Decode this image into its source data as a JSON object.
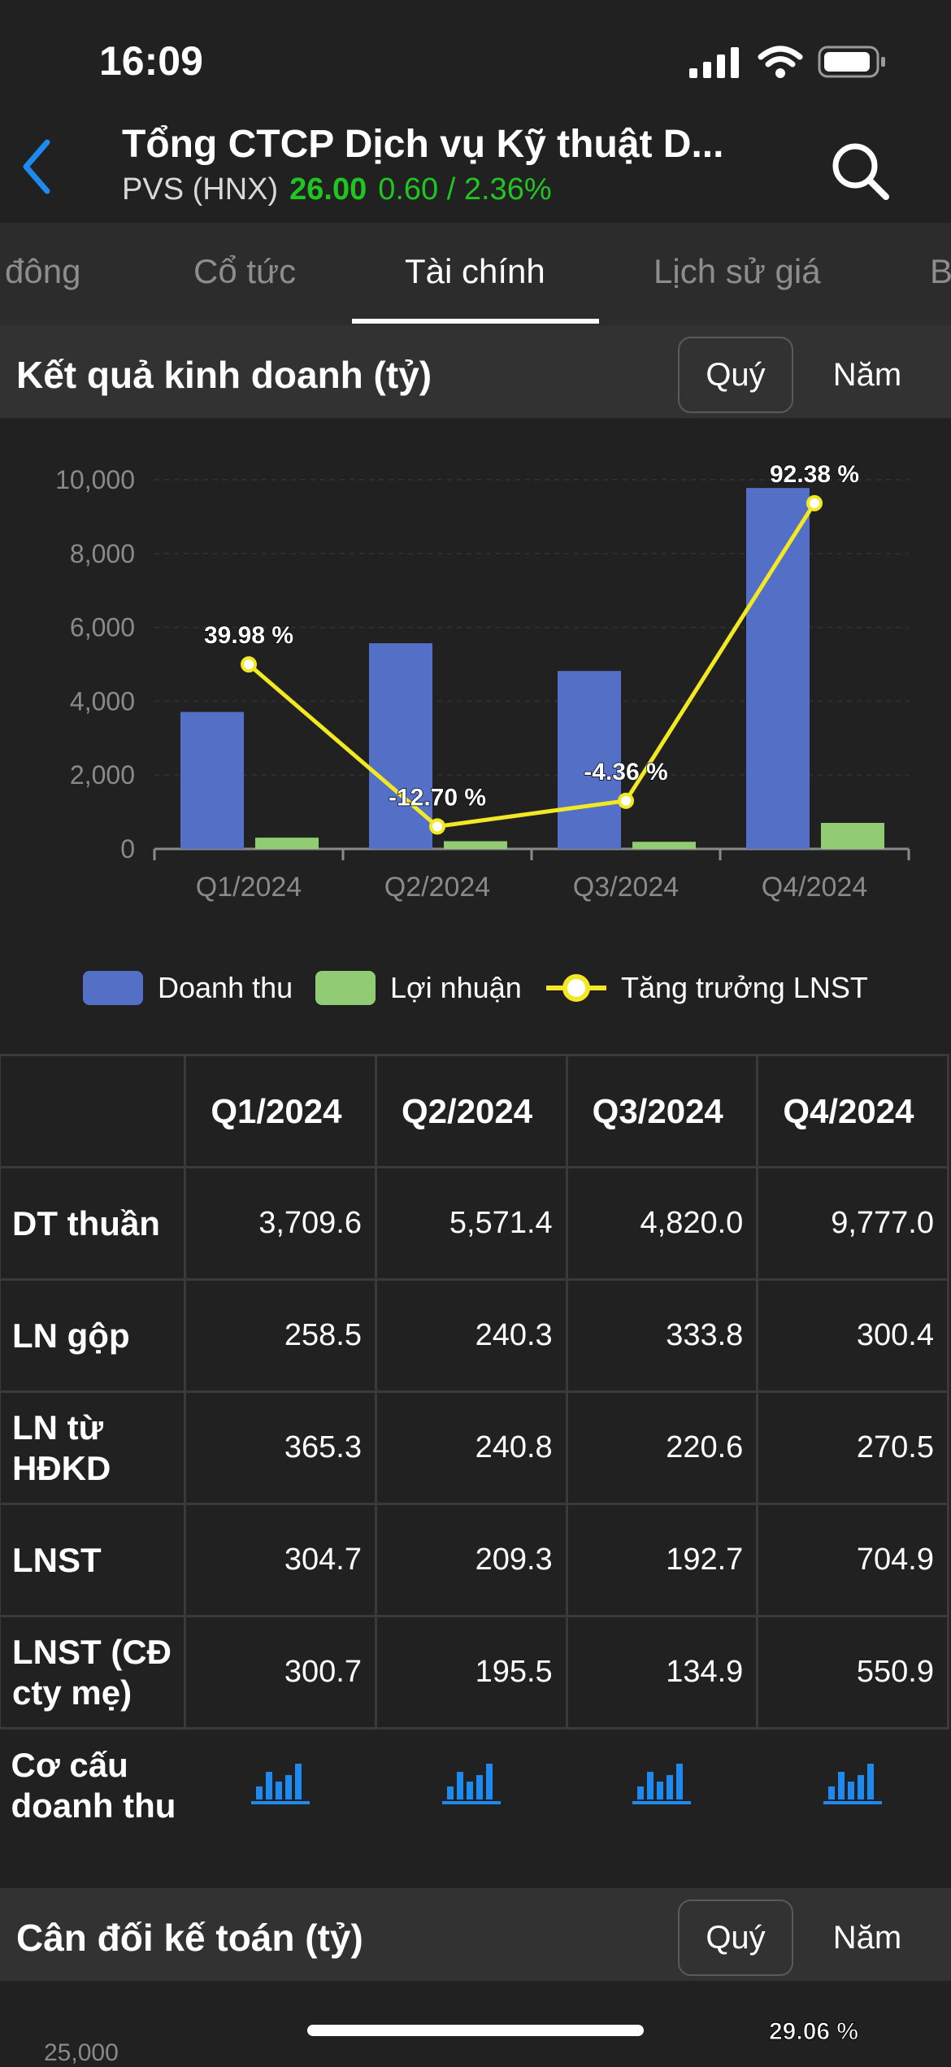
{
  "status": {
    "time": "16:09"
  },
  "header": {
    "title": "Tổng CTCP Dịch vụ Kỹ thuật D...",
    "ticker": "PVS (HNX)",
    "price": "26.00",
    "change": "0.60 / 2.36%"
  },
  "tabs": [
    {
      "label": "đông"
    },
    {
      "label": "Cổ tức"
    },
    {
      "label": "Tài chính"
    },
    {
      "label": "Lịch sử giá"
    },
    {
      "label": "B"
    }
  ],
  "section1": {
    "title": "Kết quả kinh doanh (tỷ)",
    "quy": "Quý",
    "nam": "Năm"
  },
  "section2": {
    "title": "Cân đối kế toán (tỷ)",
    "quy": "Quý",
    "nam": "Năm",
    "partial_label": "29.06 %",
    "partial_tick": "25,000"
  },
  "colors": {
    "revenue": "#5470c6",
    "profit": "#91cc75",
    "growth": "#f3e824",
    "up": "#21c521",
    "accent": "#1e8af0"
  },
  "chart_data": {
    "type": "bar",
    "categories": [
      "Q1/2024",
      "Q2/2024",
      "Q3/2024",
      "Q4/2024"
    ],
    "series": [
      {
        "name": "Doanh thu",
        "type": "bar",
        "values": [
          3709.6,
          5571.4,
          4820.0,
          9777.0
        ]
      },
      {
        "name": "Lợi nhuận",
        "type": "bar",
        "values": [
          304.7,
          209.3,
          192.7,
          704.9
        ]
      },
      {
        "name": "Tăng trưởng LNST",
        "type": "line",
        "values": [
          39.98,
          -12.7,
          -4.36,
          92.38
        ],
        "labels": [
          "39.98 %",
          "-12.70 %",
          "-4.36 %",
          "92.38 %"
        ]
      }
    ],
    "yticks": [
      "0",
      "2,000",
      "4,000",
      "6,000",
      "8,000",
      "10,000"
    ],
    "ylim": [
      0,
      10000
    ],
    "growth_range": [
      -20,
      100
    ],
    "grid": true,
    "legend": "bottom"
  },
  "legend": {
    "revenue": "Doanh thu",
    "profit": "Lợi nhuận",
    "growth": "Tăng trưởng LNST"
  },
  "table": {
    "columns": [
      "Q1/2024",
      "Q2/2024",
      "Q3/2024",
      "Q4/2024"
    ],
    "rows": [
      {
        "label": "DT thuần",
        "values": [
          "3,709.6",
          "5,571.4",
          "4,820.0",
          "9,777.0"
        ]
      },
      {
        "label": "LN gộp",
        "values": [
          "258.5",
          "240.3",
          "333.8",
          "300.4"
        ]
      },
      {
        "label": "LN từ HĐKD",
        "values": [
          "365.3",
          "240.8",
          "220.6",
          "270.5"
        ]
      },
      {
        "label": "LNST",
        "values": [
          "304.7",
          "209.3",
          "192.7",
          "704.9"
        ]
      },
      {
        "label": "LNST (CĐ cty mẹ)",
        "values": [
          "300.7",
          "195.5",
          "134.9",
          "550.9"
        ]
      }
    ],
    "structure_label": "Cơ cấu doanh thu"
  }
}
